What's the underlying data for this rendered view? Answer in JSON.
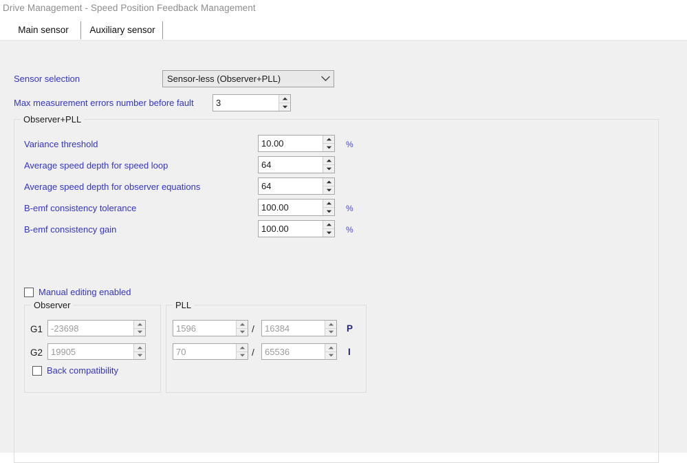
{
  "window": {
    "title": "Drive Management - Speed Position Feedback Management"
  },
  "tabs": [
    {
      "label": "Main sensor",
      "selected": true
    },
    {
      "label": "Auxiliary sensor",
      "selected": false
    }
  ],
  "form": {
    "sensor_selection": {
      "label": "Sensor selection",
      "value": "Sensor-less (Observer+PLL)",
      "arrow_icon": "chevron-down-icon"
    },
    "max_errors": {
      "label": "Max measurement errors number before fault",
      "value": "3"
    }
  },
  "observer_pll_group": {
    "title": "Observer+PLL",
    "fields": [
      {
        "label": "Variance threshold",
        "value": "10.00",
        "unit": "%"
      },
      {
        "label": "Average speed depth for speed loop",
        "value": "64",
        "unit": ""
      },
      {
        "label": "Average speed depth for observer equations",
        "value": "64",
        "unit": ""
      },
      {
        "label": "B-emf consistency tolerance",
        "value": "100.00",
        "unit": "%"
      },
      {
        "label": "B-emf consistency gain",
        "value": "100.00",
        "unit": "%"
      }
    ],
    "manual_editing": {
      "label": "Manual editing enabled",
      "checked": false
    },
    "observer_group": {
      "title": "Observer",
      "rows": [
        {
          "label": "G1",
          "value": "-23698"
        },
        {
          "label": "G2",
          "value": "19905"
        }
      ],
      "back_compatibility": {
        "label": "Back compatibility",
        "checked": false
      }
    },
    "pll_group": {
      "title": "PLL",
      "separator": "/",
      "rows": [
        {
          "numerator": "1596",
          "denominator": "16384",
          "suffix": "P"
        },
        {
          "numerator": "70",
          "denominator": "65536",
          "suffix": "I"
        }
      ]
    }
  },
  "colors": {
    "label_blue": "#3333cc",
    "panel_bg": "#f0f0f0",
    "title_gray": "#8d8d8d",
    "disabled_text": "#9b9b9b"
  }
}
